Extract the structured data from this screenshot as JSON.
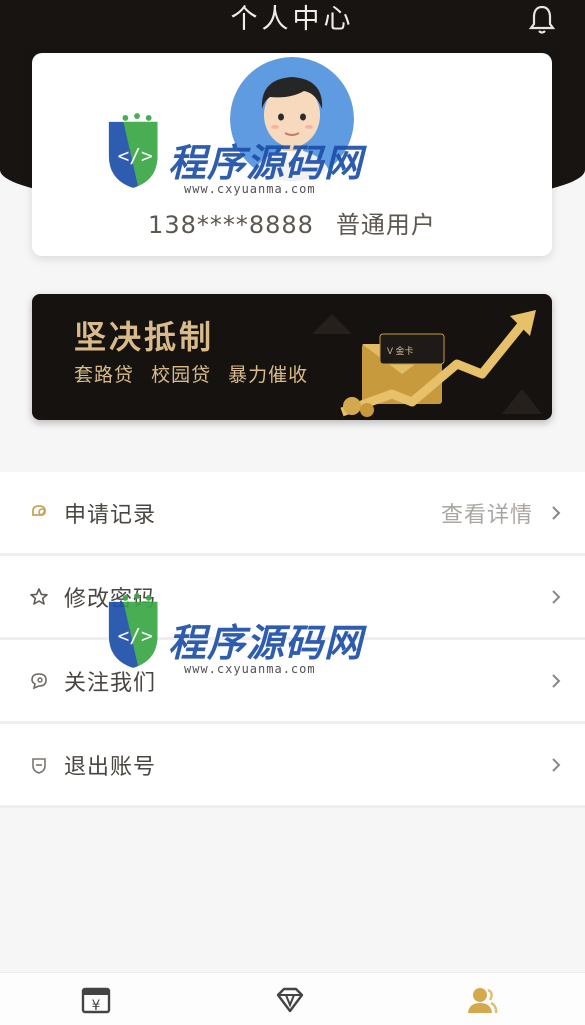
{
  "header": {
    "title": "个人中心",
    "bell_icon": "bell-icon"
  },
  "profile": {
    "avatar_icon": "avatar",
    "phone": "138****8888",
    "user_type": "普通用户"
  },
  "banner": {
    "title": "坚决抵制",
    "subtitle": [
      "套路贷",
      "校园贷",
      "暴力催收"
    ],
    "accent": "#d9bb8a"
  },
  "menu": {
    "items": [
      {
        "label": "申请记录",
        "detail": "查看详情",
        "icon": "applications-icon"
      },
      {
        "label": "修改密码",
        "detail": "",
        "icon": "star-icon"
      },
      {
        "label": "关注我们",
        "detail": "",
        "icon": "chat-icon"
      },
      {
        "label": "退出账号",
        "detail": "",
        "icon": "shield-icon"
      }
    ]
  },
  "bottom_nav": {
    "tabs": [
      {
        "icon": "loan-icon",
        "active": false
      },
      {
        "icon": "diamond-icon",
        "active": false
      },
      {
        "icon": "user-icon",
        "active": true
      }
    ],
    "active_color": "#d4a94e"
  },
  "watermark": {
    "text_a": "程序",
    "text_b": "源码网",
    "url": "www.cxyuanma.com"
  }
}
